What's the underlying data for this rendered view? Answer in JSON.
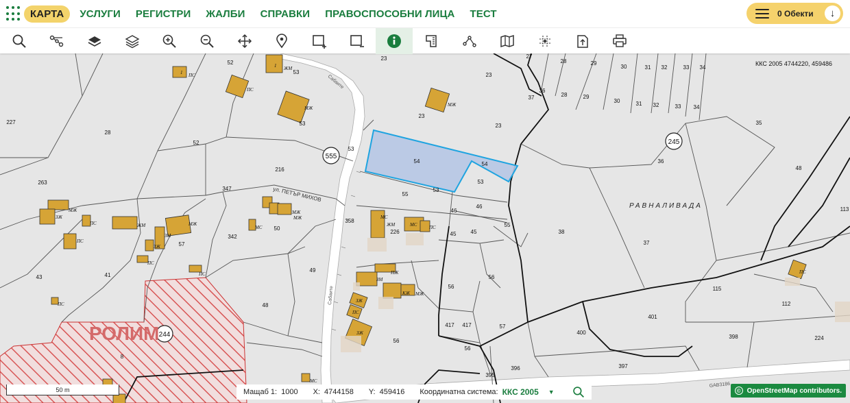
{
  "nav": {
    "items": [
      {
        "label": "КАРТА",
        "active": true
      },
      {
        "label": "УСЛУГИ"
      },
      {
        "label": "РЕГИСТРИ"
      },
      {
        "label": "ЖАЛБИ"
      },
      {
        "label": "СПРАВКИ"
      },
      {
        "label": "ПРАВОСПОСОБНИ ЛИЦА"
      },
      {
        "label": "ТЕСТ"
      }
    ],
    "objects_label": "0 Обекти",
    "objects_icon": "menu-icon",
    "download_icon": "arrow-down-icon",
    "brand_color": "#1a7d3e",
    "accent_color": "#f3d36b"
  },
  "toolbar": {
    "tools": [
      "search-icon",
      "route-icon",
      "layers-icon",
      "layers-outline-icon",
      "zoom-in-icon",
      "zoom-out-icon",
      "pan-icon",
      "location-pin-icon",
      "add-rectangle-icon",
      "remove-rectangle-icon",
      "info-icon",
      "measure-area-icon",
      "measure-distance-icon",
      "map-icon",
      "coordinate-icon",
      "export-icon",
      "print-icon"
    ],
    "active_tool": "info-icon"
  },
  "map": {
    "coord_info": "ККС 2005 4744220, 459486",
    "selected_parcel": "54",
    "area_name": "РАВНАЛИВАДА",
    "street_1": "ул. ПЕТЪР МИХОВ",
    "street_2": "Сабаите",
    "street_3": "Сабаите",
    "road_label": "GAB3186",
    "zone_label": "РОЛИМ",
    "circles": [
      "555",
      "245",
      "244"
    ],
    "parcel_numbers": [
      "23",
      "27",
      "28",
      "29",
      "30",
      "31",
      "32",
      "33",
      "34",
      "36",
      "37",
      "35",
      "36",
      "48",
      "113",
      "23",
      "23",
      "54",
      "54",
      "53",
      "55",
      "46",
      "46",
      "45",
      "45",
      "55",
      "38",
      "37",
      "56",
      "56",
      "115",
      "112",
      "401",
      "400",
      "398",
      "224",
      "397",
      "396",
      "395",
      "417",
      "417",
      "57",
      "56",
      "56",
      "226",
      "358",
      "50",
      "49",
      "48",
      "342",
      "57",
      "41",
      "43",
      "216",
      "347",
      "52",
      "52",
      "53",
      "53",
      "28",
      "227",
      "263",
      "8",
      "27",
      "28",
      "29",
      "30",
      "31",
      "32",
      "33",
      "34",
      "36",
      "1"
    ],
    "building_labels": [
      "МЖ",
      "ПС",
      "ЖМ",
      "ЗМ",
      "ЗЖ",
      "МС",
      "ПЖ",
      "КЖ"
    ]
  },
  "status": {
    "scale_bar": "50 m",
    "scale_label": "Мащаб 1:",
    "scale_value": "1000",
    "x_label": "X:",
    "x_value": "4744158",
    "y_label": "Y:",
    "y_value": "459416",
    "system_label": "Координатна система:",
    "system_value": "ККС 2005",
    "osm_text": "OpenStreetMap contributors."
  }
}
